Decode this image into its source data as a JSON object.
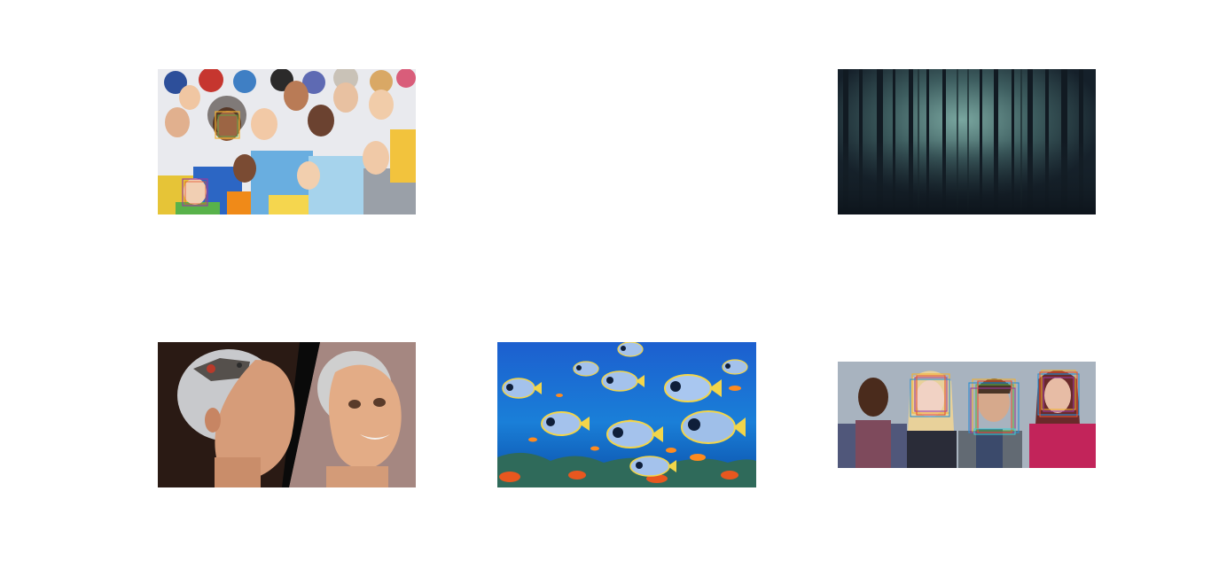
{
  "figure": {
    "subplots": [
      {
        "name": "crowd-photo",
        "faces_detected": 2
      },
      {
        "name": "empty-panel"
      },
      {
        "name": "forest-photo",
        "faces_detected": 0
      },
      {
        "name": "robot-sophia-photo",
        "faces_detected": 0
      },
      {
        "name": "coral-reef-fish-photo",
        "faces_detected": 0
      },
      {
        "name": "four-faces-photo",
        "faces_detected": 2
      }
    ],
    "box_colors": [
      "#f2b233",
      "#9a3c9c",
      "#2a8fd1",
      "#e4542f",
      "#58b24a",
      "#3ad1d6"
    ]
  }
}
